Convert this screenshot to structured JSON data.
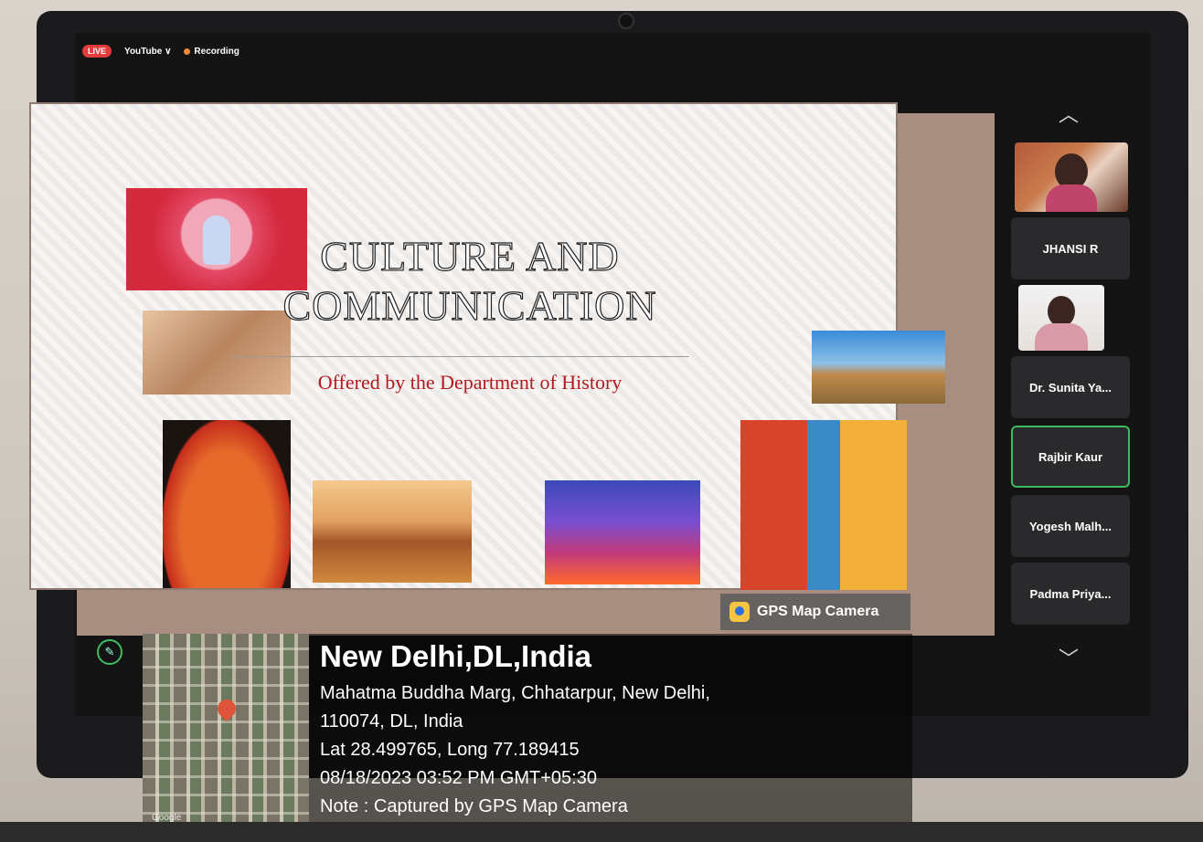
{
  "topbar": {
    "live": "LIVE",
    "platform": "YouTube ∨",
    "recording": "Recording"
  },
  "slide": {
    "title_line1": "CULTURE AND",
    "title_line2": "COMMUNICATION",
    "subtitle": "Offered by the Department of History"
  },
  "participants": [
    {
      "name": "JHANSI R"
    },
    {
      "name": "Dr. Sunita Ya..."
    },
    {
      "name": "Rajbir Kaur"
    },
    {
      "name": "Yogesh Malh..."
    },
    {
      "name": "Padma Priya..."
    }
  ],
  "gps": {
    "badge": "GPS Map Camera",
    "city": "New Delhi,DL,India",
    "address1": "Mahatma Buddha Marg, Chhatarpur, New Delhi,",
    "address2": "110074, DL, India",
    "latlong": "Lat 28.499765, Long 77.189415",
    "datetime": "08/18/2023 03:52 PM GMT+05:30",
    "note": "Note : Captured by GPS Map Camera",
    "map_brand": "Google"
  },
  "colors": {
    "accent_green": "#3dbb5e",
    "live_red": "#e23b3b",
    "subtitle_red": "#b3191f"
  }
}
